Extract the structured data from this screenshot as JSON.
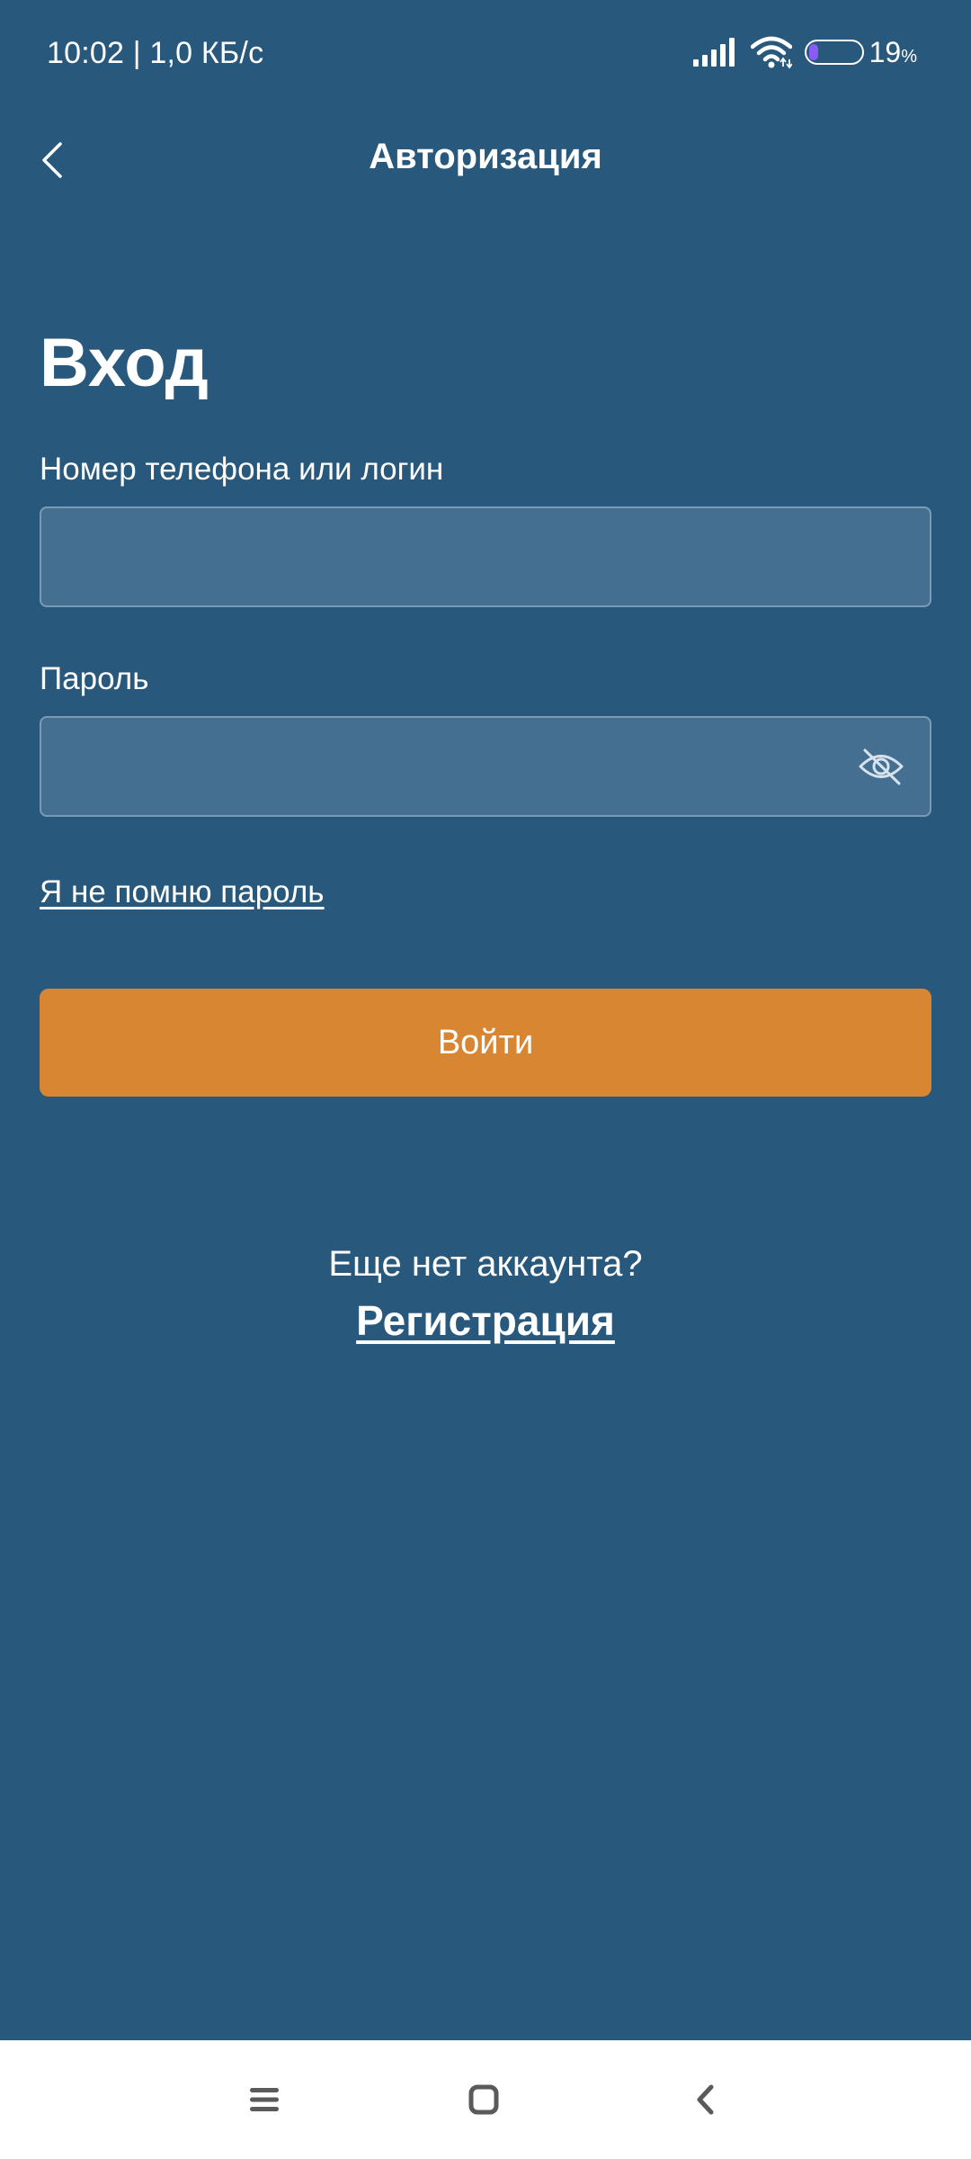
{
  "status_bar": {
    "time": "10:02 | 1,0 КБ/с",
    "battery_level": "19",
    "battery_unit": "%",
    "battery_fraction": 0.19,
    "battery_color": "#8a5cf5"
  },
  "app_bar": {
    "title": "Авторизация",
    "back_icon": "chevron-left-icon"
  },
  "login_form": {
    "heading": "Вход",
    "login_label": "Номер телефона или логин",
    "login_value": "",
    "password_label": "Пароль",
    "password_value": "",
    "password_toggle_icon": "eye-off-icon",
    "forgot_link": "Я не помню пароль",
    "submit_label": "Войти"
  },
  "signup": {
    "prompt": "Еще нет аккаунта?",
    "link": "Регистрация"
  },
  "nav_bar": {
    "menu_icon": "menu-icon",
    "home_icon": "home-square-icon",
    "back_icon": "back-chevron-icon"
  },
  "colors": {
    "background": "#28587c",
    "input_background": "#456f90",
    "input_border": "#7a9bb6",
    "accent": "#d98632",
    "text": "#ffffff",
    "nav_background": "#ffffff"
  }
}
